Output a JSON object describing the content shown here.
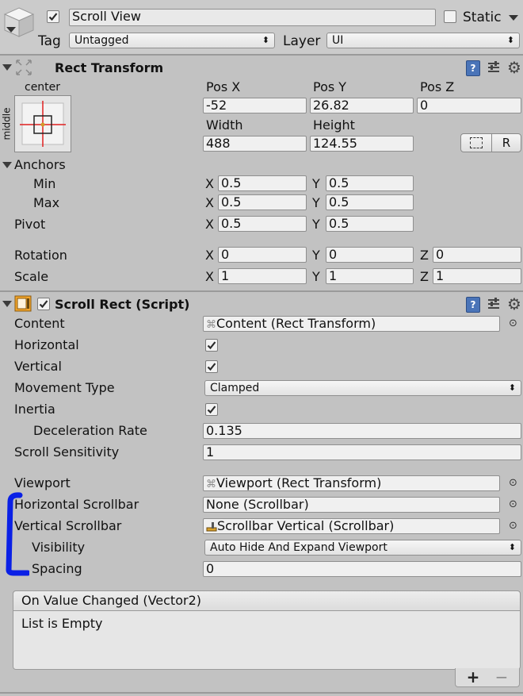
{
  "header": {
    "object_name": "Scroll View",
    "static_label": "Static",
    "tag_label": "Tag",
    "tag_value": "Untagged",
    "layer_label": "Layer",
    "layer_value": "UI"
  },
  "rect_transform": {
    "title": "Rect Transform",
    "anchor_preset_top": "center",
    "anchor_preset_side": "middle",
    "pos_x_label": "Pos X",
    "pos_y_label": "Pos Y",
    "pos_z_label": "Pos Z",
    "pos_x": "-52",
    "pos_y": "26.82",
    "pos_z": "0",
    "width_label": "Width",
    "height_label": "Height",
    "width": "488",
    "height": "124.55",
    "r_button": "R",
    "anchors_label": "Anchors",
    "min_label": "Min",
    "max_label": "Max",
    "pivot_label": "Pivot",
    "anchors_min_x": "0.5",
    "anchors_min_y": "0.5",
    "anchors_max_x": "0.5",
    "anchors_max_y": "0.5",
    "pivot_x": "0.5",
    "pivot_y": "0.5",
    "rotation_label": "Rotation",
    "scale_label": "Scale",
    "rotation_x": "0",
    "rotation_y": "0",
    "rotation_z": "0",
    "scale_x": "1",
    "scale_y": "1",
    "scale_z": "1",
    "axis_x": "X",
    "axis_y": "Y",
    "axis_z": "Z"
  },
  "scroll_rect": {
    "title": "Scroll Rect (Script)",
    "content_label": "Content",
    "content_value": "Content (Rect Transform)",
    "horizontal_label": "Horizontal",
    "vertical_label": "Vertical",
    "movement_type_label": "Movement Type",
    "movement_type_value": "Clamped",
    "inertia_label": "Inertia",
    "deceleration_rate_label": "Deceleration Rate",
    "deceleration_rate_value": "0.135",
    "scroll_sensitivity_label": "Scroll Sensitivity",
    "scroll_sensitivity_value": "1",
    "viewport_label": "Viewport",
    "viewport_value": "Viewport (Rect Transform)",
    "h_scrollbar_label": "Horizontal Scrollbar",
    "h_scrollbar_value": "None (Scrollbar)",
    "v_scrollbar_label": "Vertical Scrollbar",
    "v_scrollbar_value": "Scrollbar Vertical (Scrollbar)",
    "visibility_label": "Visibility",
    "visibility_value": "Auto Hide And Expand Viewport",
    "spacing_label": "Spacing",
    "spacing_value": "0"
  },
  "event": {
    "title": "On Value Changed (Vector2)",
    "empty_text": "List is Empty",
    "add_button": "+",
    "remove_button": "−"
  },
  "colors": {
    "panel_bg": "#c2c2c2",
    "field_bg": "#f0f0f0",
    "annotation_blue": "#0a20e6"
  }
}
